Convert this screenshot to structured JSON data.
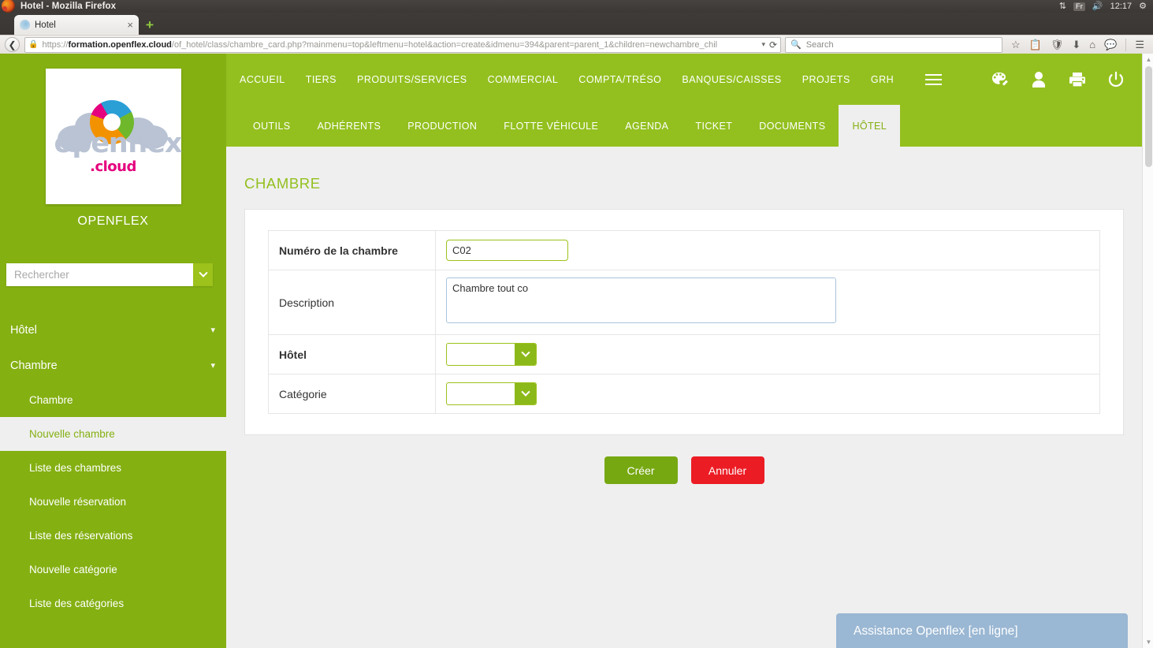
{
  "system": {
    "window_title": "Hotel - Mozilla Firefox",
    "tray": {
      "network_icon": "network-up-down-icon",
      "keyboard_layout": "Fr",
      "volume_icon": "volume-icon",
      "clock": "12:17",
      "settings_icon": "gear-icon"
    }
  },
  "browser": {
    "tab": {
      "title": "Hotel",
      "close_label": "×"
    },
    "new_tab_label": "+",
    "back_icon": "back-arrow-icon",
    "url": {
      "scheme": "https://",
      "host": "formation.openflex.cloud",
      "path": "/of_hotel/class/chambre_card.php?mainmenu=top&leftmenu=hotel&action=create&idmenu=394&parent=parent_1&children=newchambre_chil",
      "lock_icon": "padlock-icon",
      "dropdown_icon": "chevron-down-icon",
      "reload_icon": "reload-icon"
    },
    "search": {
      "placeholder": "Search",
      "icon": "search-icon"
    },
    "toolbar_icons": [
      "star-icon",
      "clipboard-icon",
      "shield-icon",
      "download-icon",
      "home-icon",
      "chat-icon",
      "hamburger-menu-icon"
    ]
  },
  "sidebar": {
    "logo": {
      "word": "openflex",
      "suffix": ".cloud",
      "alt": "openflex-cloud-logo"
    },
    "brand": "OPENFLEX",
    "search": {
      "placeholder": "Rechercher",
      "value": "",
      "dropdown_icon": "chevron-down-icon"
    },
    "menu": [
      {
        "label": "Hôtel",
        "type": "top",
        "caret": "caret-down-icon"
      },
      {
        "label": "Chambre",
        "type": "top",
        "caret": "caret-down-icon"
      },
      {
        "label": "Chambre",
        "type": "sub",
        "active": false
      },
      {
        "label": "Nouvelle chambre",
        "type": "sub",
        "active": true
      },
      {
        "label": "Liste des chambres",
        "type": "sub",
        "active": false
      },
      {
        "label": "Nouvelle réservation",
        "type": "sub",
        "active": false
      },
      {
        "label": "Liste des réservations",
        "type": "sub",
        "active": false
      },
      {
        "label": "Nouvelle catégorie",
        "type": "sub",
        "active": false
      },
      {
        "label": "Liste des catégories",
        "type": "sub",
        "active": false
      }
    ]
  },
  "topnav": {
    "items": [
      "ACCUEIL",
      "TIERS",
      "PRODUITS/SERVICES",
      "COMMERCIAL",
      "COMPTA/TRÉSO",
      "BANQUES/CAISSES",
      "PROJETS",
      "GRH"
    ],
    "burger_icon": "hamburger-menu-icon",
    "icons": [
      "palette-icon",
      "user-icon",
      "printer-icon",
      "power-icon"
    ]
  },
  "subnav": {
    "items": [
      "OUTILS",
      "ADHÉRENTS",
      "PRODUCTION",
      "FLOTTE VÉHICULE",
      "AGENDA",
      "TICKET",
      "DOCUMENTS",
      "HÔTEL"
    ],
    "active": "HÔTEL"
  },
  "main": {
    "title": "CHAMBRE",
    "fields": [
      {
        "label": "Numéro de la chambre",
        "type": "text",
        "value": "C02",
        "bold": true
      },
      {
        "label": "Description",
        "type": "textarea",
        "value": "Chambre tout co",
        "bold": false
      },
      {
        "label": "Hôtel",
        "type": "select",
        "value": "",
        "bold": true
      },
      {
        "label": "Catégorie",
        "type": "select",
        "value": "",
        "bold": false
      }
    ],
    "buttons": {
      "create": "Créer",
      "cancel": "Annuler"
    }
  },
  "assistance": {
    "label": "Assistance Openflex [en ligne]"
  },
  "colors": {
    "brand_green": "#93c01f",
    "sidebar_green": "#84b012",
    "create_green": "#76a812",
    "cancel_red": "#ec1c24",
    "assistance_blue": "#9ab7d3",
    "page_bg": "#efefef"
  }
}
